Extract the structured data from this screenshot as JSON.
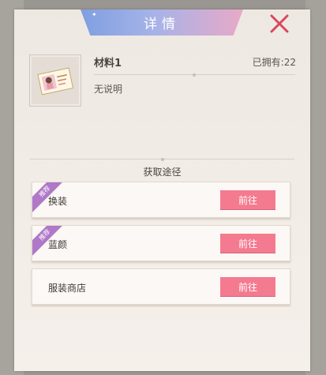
{
  "modal": {
    "title": "详情"
  },
  "item": {
    "name": "材料1",
    "owned": "已拥有:22",
    "description": "无说明"
  },
  "sources": {
    "heading": "获取途径",
    "rows": [
      {
        "label": "换装",
        "button": "前往",
        "tag": "推荐"
      },
      {
        "label": "蓝颜",
        "button": "前往",
        "tag": "推荐"
      },
      {
        "label": "服装商店",
        "button": "前往"
      }
    ]
  },
  "colors": {
    "panel": "#f3ede7",
    "button": "#f47a8f",
    "tag": "#b078c8",
    "close": "#d9475c"
  }
}
